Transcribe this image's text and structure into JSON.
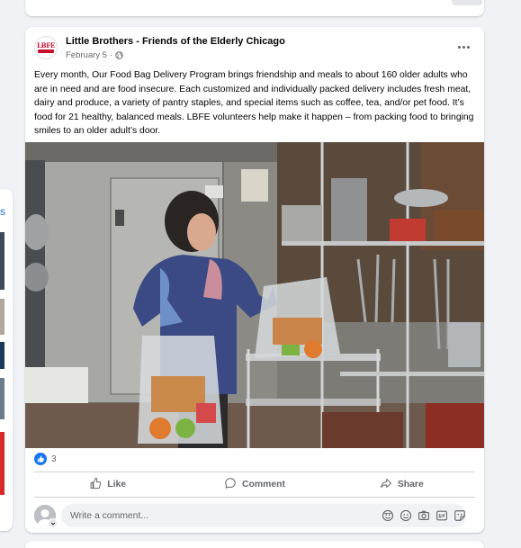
{
  "left_column": {
    "partial_text": "s"
  },
  "post": {
    "page_name": "Little Brothers - Friends of the Elderly Chicago",
    "logo_text": "LBFE",
    "date": "February 5",
    "separator": "·",
    "audience_icon": "globe-icon",
    "more_icon": "more-options-icon",
    "body": "Every month, Our Food Bag Delivery Program brings friendship and meals to about 160 older adults who are in need and are food insecure. Each customized and individually packed delivery includes fresh meat, dairy and produce, a variety of pantry staples, and special items such as coffee, tea, and/or pet food. It’s food for 21 healthy, balanced meals. LBFE volunteers help make it happen – from packing food to bringing smiles to an older adult’s door.",
    "photo_icon": "volunteer-packing-food-bags-photo"
  },
  "reactions": {
    "icon": "like-reaction-icon",
    "count": "3"
  },
  "actions": {
    "like_label": "Like",
    "comment_label": "Comment",
    "share_label": "Share"
  },
  "comment_box": {
    "placeholder": "Write a comment...",
    "tools": [
      "avatar-sticker-icon",
      "emoji-icon",
      "camera-icon",
      "gif-icon",
      "sticker-icon"
    ]
  },
  "colors": {
    "brand_blue": "#1877f2",
    "text_secondary": "#65676b",
    "logo_red": "#c8102e"
  }
}
